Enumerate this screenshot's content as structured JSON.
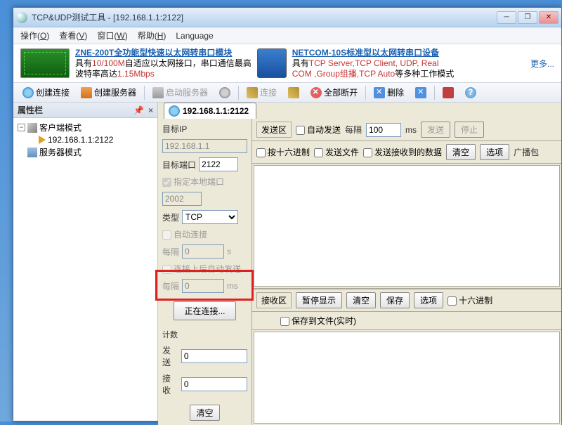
{
  "window": {
    "title": "TCP&UDP测试工具 - [192.168.1.1:2122]"
  },
  "menu": {
    "operate": "操作(O)",
    "view": "查看(V)",
    "window": "窗口(W)",
    "help": "帮助(H)",
    "language": "Language"
  },
  "promo": {
    "left_title": "ZNE-200T全功能型快速以太网转串口模块",
    "left_line1_pre": "具有",
    "left_line1_red": "10/100M",
    "left_line1_post": "自适应以太网接口，串口通信最高",
    "left_line2_pre": "波特率高达",
    "left_line2_red": "1.15Mbps",
    "right_title": "NETCOM-10S标准型以太网转串口设备",
    "right_line1_pre": "具有",
    "right_line1_red": "TCP Server,TCP Client, UDP, Real",
    "right_line2_red": "COM ,Group组播,TCP Auto",
    "right_line2_post": "等多种工作模式",
    "more": "更多..."
  },
  "toolbar": {
    "create_conn": "创建连接",
    "create_server": "创建服务器",
    "start_server": "启动服务器",
    "connect": "连接",
    "disconnect_all": "全部断开",
    "delete": "删除"
  },
  "sidebar": {
    "header": "属性栏",
    "items": [
      "客户端模式",
      "192.168.1.1:2122",
      "服务器模式"
    ]
  },
  "tab": {
    "label": "192.168.1.1:2122"
  },
  "conn": {
    "target_ip_lbl": "目标IP",
    "target_ip": "192.168.1.1",
    "target_port_lbl": "目标端口",
    "target_port": "2122",
    "local_port_chk": "指定本地端口",
    "local_port": "2002",
    "type_lbl": "类型",
    "type": "TCP",
    "auto_conn": "自动连接",
    "interval_lbl": "每隔",
    "interval": "0",
    "interval_unit": "s",
    "auto_send_after": "连接上后自动发送",
    "interval2_lbl": "每隔",
    "interval2": "0",
    "interval2_unit": "ms",
    "connecting_btn": "正在连接...",
    "count_lbl": "计数",
    "send_lbl": "发送",
    "send_count": "0",
    "recv_lbl": "接收",
    "recv_count": "0",
    "clear_btn": "清空"
  },
  "send": {
    "area_lbl": "发送区",
    "auto_send": "自动发送",
    "interval_lbl": "每隔",
    "interval": "100",
    "interval_unit": "ms",
    "send_btn": "发送",
    "stop_btn": "停止",
    "hex": "按十六进制",
    "send_file": "发送文件",
    "send_recv": "发送接收到的数据",
    "clear": "清空",
    "options": "选项",
    "broadcast": "广播包"
  },
  "recv": {
    "area_lbl": "接收区",
    "pause": "暂停显示",
    "clear": "清空",
    "save": "保存",
    "options": "选项",
    "hex": "十六进制",
    "save_to_file": "保存到文件(实时)"
  }
}
